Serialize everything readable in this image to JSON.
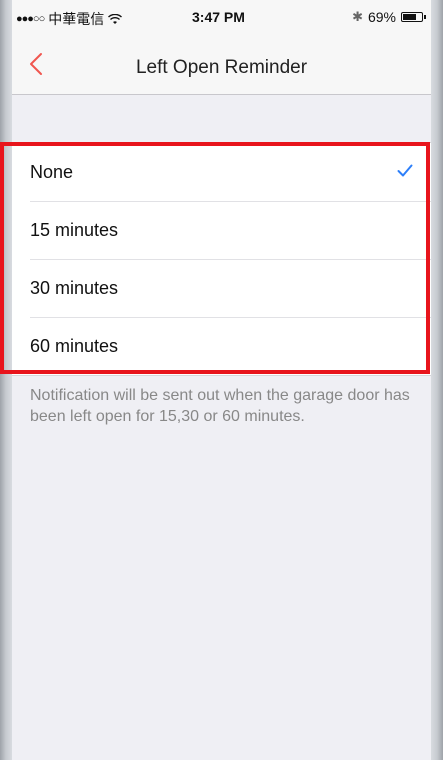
{
  "status_bar": {
    "carrier": "中華電信",
    "signal": "●●●○○",
    "time": "3:47 PM",
    "battery": "69%"
  },
  "nav": {
    "title": "Left Open Reminder",
    "back_icon": "chevron-left-icon"
  },
  "options": [
    {
      "label": "None",
      "selected": true
    },
    {
      "label": "15 minutes",
      "selected": false
    },
    {
      "label": "30 minutes",
      "selected": false
    },
    {
      "label": "60 minutes",
      "selected": false
    }
  ],
  "note": "Notification will be sent out when the garage door has been left open for 15,30 or 60 minutes.",
  "colors": {
    "accent": "#f0564f",
    "check": "#2d7ff9",
    "highlight": "#e8141c"
  }
}
